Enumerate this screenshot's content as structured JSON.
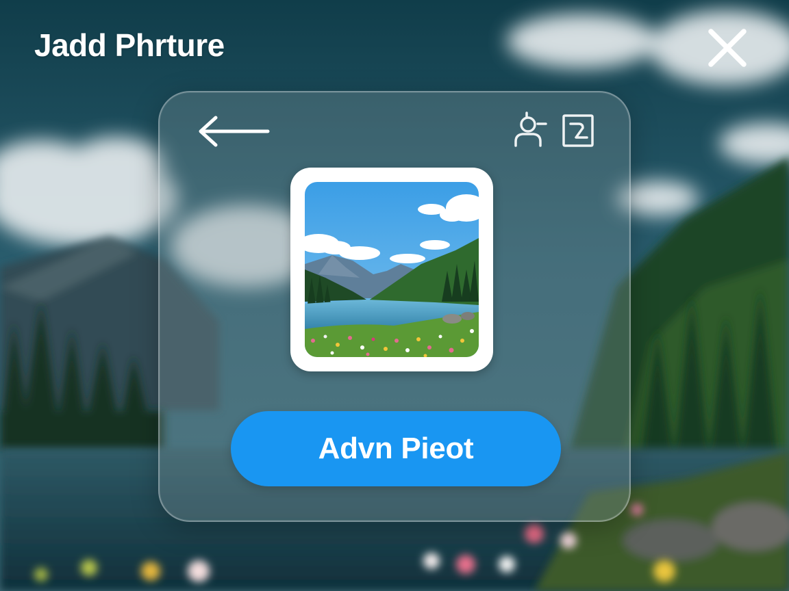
{
  "header": {
    "title": "Jadd Phrture",
    "close_icon": "close-icon"
  },
  "dialog": {
    "back_icon": "arrow-left-icon",
    "person_icon": "person-add-icon",
    "frame_icon": "image-frame-icon",
    "thumbnail_icon": "landscape-photo-thumbnail",
    "primary_button_label": "Advn Pieot"
  },
  "colors": {
    "accent": "#1996f2",
    "text": "#ffffff"
  }
}
